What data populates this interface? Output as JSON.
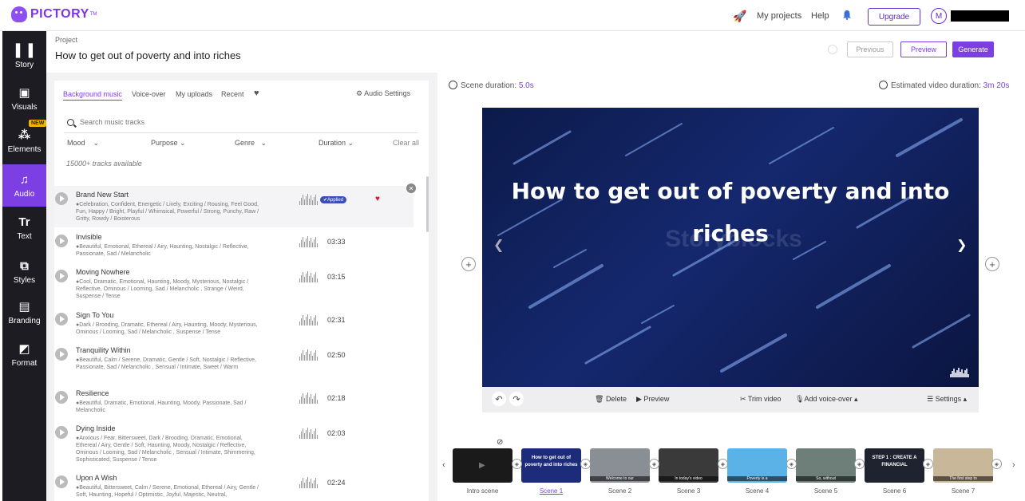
{
  "app": {
    "logo_text": "PICTORY",
    "logo_tm": "TM",
    "nav": [
      "My projects",
      "Help"
    ],
    "upgrade_label": "Upgrade",
    "avatar_letter": "M"
  },
  "sidebar": {
    "items": [
      {
        "label": "Story",
        "icon": "▌▐"
      },
      {
        "label": "Visuals",
        "icon": "▣"
      },
      {
        "label": "Elements",
        "icon": "⁂",
        "badge": "NEW"
      },
      {
        "label": "Audio",
        "icon": "♫"
      },
      {
        "label": "Text",
        "icon": "Tr"
      },
      {
        "label": "Styles",
        "icon": "⧉"
      },
      {
        "label": "Branding",
        "icon": "▤"
      },
      {
        "label": "Format",
        "icon": "◩"
      }
    ]
  },
  "project": {
    "label": "Project",
    "title": "How to get out of poverty and into riches",
    "previous_label": "Previous",
    "preview_label": "Preview",
    "generate_label": "Generate"
  },
  "audio": {
    "tabs": [
      "Background music",
      "Voice-over",
      "My uploads",
      "Recent"
    ],
    "settings_label": "Audio Settings",
    "search_placeholder": "Search music tracks",
    "filters": [
      "Mood",
      "Purpose",
      "Genre",
      "Duration"
    ],
    "clear_all": "Clear all",
    "tracks_available": "15000+ tracks available",
    "applied_label": "✔Applied",
    "tracks": [
      {
        "name": "Brand New Start",
        "tags": "Celebration, Confident, Energetic / Lively, Exciting / Rousing, Feel Good, Fun, Happy / Bright, Playful / Whimsical, Powerful / Strong, Punchy, Raw / Gritty, Rowdy / Boisterous",
        "duration": ""
      },
      {
        "name": "Invisible",
        "tags": "Beautiful, Emotional, Ethereal / Airy, Haunting, Nostalgic / Reflective, Passionate, Sad / Melancholic",
        "duration": "03:33"
      },
      {
        "name": "Moving Nowhere",
        "tags": "Cool, Dramatic, Emotional, Haunting, Moody, Mysterious, Nostalgic / Reflective, Ominous / Looming, Sad / Melancholic , Strange / Weird, Suspense / Tense",
        "duration": "03:15"
      },
      {
        "name": "Sign To You",
        "tags": "Dark / Brooding, Dramatic, Ethereal / Airy, Haunting, Moody, Mysterious, Ominous / Looming, Sad / Melancholic , Suspense / Tense",
        "duration": "02:31"
      },
      {
        "name": "Tranquility Within",
        "tags": "Beautiful, Calm / Serene, Dramatic, Gentle / Soft, Nostalgic / Reflective, Passionate, Sad / Melancholic , Sensual / Intimate, Sweet / Warm",
        "duration": "02:50"
      },
      {
        "name": "Resilience",
        "tags": "Beautiful, Dramatic, Emotional, Haunting, Moody, Passionate, Sad / Melancholic",
        "duration": "02:18"
      },
      {
        "name": "Dying Inside",
        "tags": "Anxious / Fear, Bittersweet, Dark / Brooding, Dramatic, Emotional, Ethereal / Airy, Gentle / Soft, Haunting, Moody, Nostalgic / Reflective, Ominous / Looming, Sad / Melancholic , Sensual / Intimate, Shimmering, Sophisticated, Suspense / Tense",
        "duration": "02:03"
      },
      {
        "name": "Upon A Wish",
        "tags": "Beautiful, Bittersweet, Calm / Serene, Emotional, Ethereal / Airy, Gentle / Soft, Haunting, Hopeful / Optimistic, Joyful, Majestic, Neutral,",
        "duration": "02:24"
      }
    ]
  },
  "preview": {
    "scene_duration_label": "Scene duration:",
    "scene_duration_value": "5.0s",
    "est_duration_label": "Estimated video duration:",
    "est_duration_value": "3m 20s",
    "video_title": "How to get out of poverty and into riches",
    "watermark": "Storyblocks",
    "toolbar": {
      "delete": "Delete",
      "preview": "Preview",
      "trim": "Trim video",
      "voiceover": "Add voice-over ▴",
      "settings": "Settings ▴"
    }
  },
  "scenes": {
    "items": [
      {
        "label": "Intro scene",
        "text": "",
        "caption": "",
        "color": "#1a1a1a"
      },
      {
        "label": "Scene 1",
        "text": "How to get out of poverty and into riches",
        "caption": "",
        "color": "#1d2c7a"
      },
      {
        "label": "Scene 2",
        "text": "",
        "caption": "Welcome to our",
        "color": "#8a8f96"
      },
      {
        "label": "Scene 3",
        "text": "",
        "caption": "In today's video",
        "color": "#3a3a3a"
      },
      {
        "label": "Scene 4",
        "text": "",
        "caption": "Poverty is a",
        "color": "#5ab2e6"
      },
      {
        "label": "Scene 5",
        "text": "",
        "caption": "So, without",
        "color": "#6e7f7a"
      },
      {
        "label": "Scene 6",
        "text": "STEP 1 : CREATE A FINANCIAL",
        "caption": "",
        "color": "#1f2330"
      },
      {
        "label": "Scene 7",
        "text": "",
        "caption": "The first step to",
        "color": "#c9b79a"
      }
    ]
  }
}
